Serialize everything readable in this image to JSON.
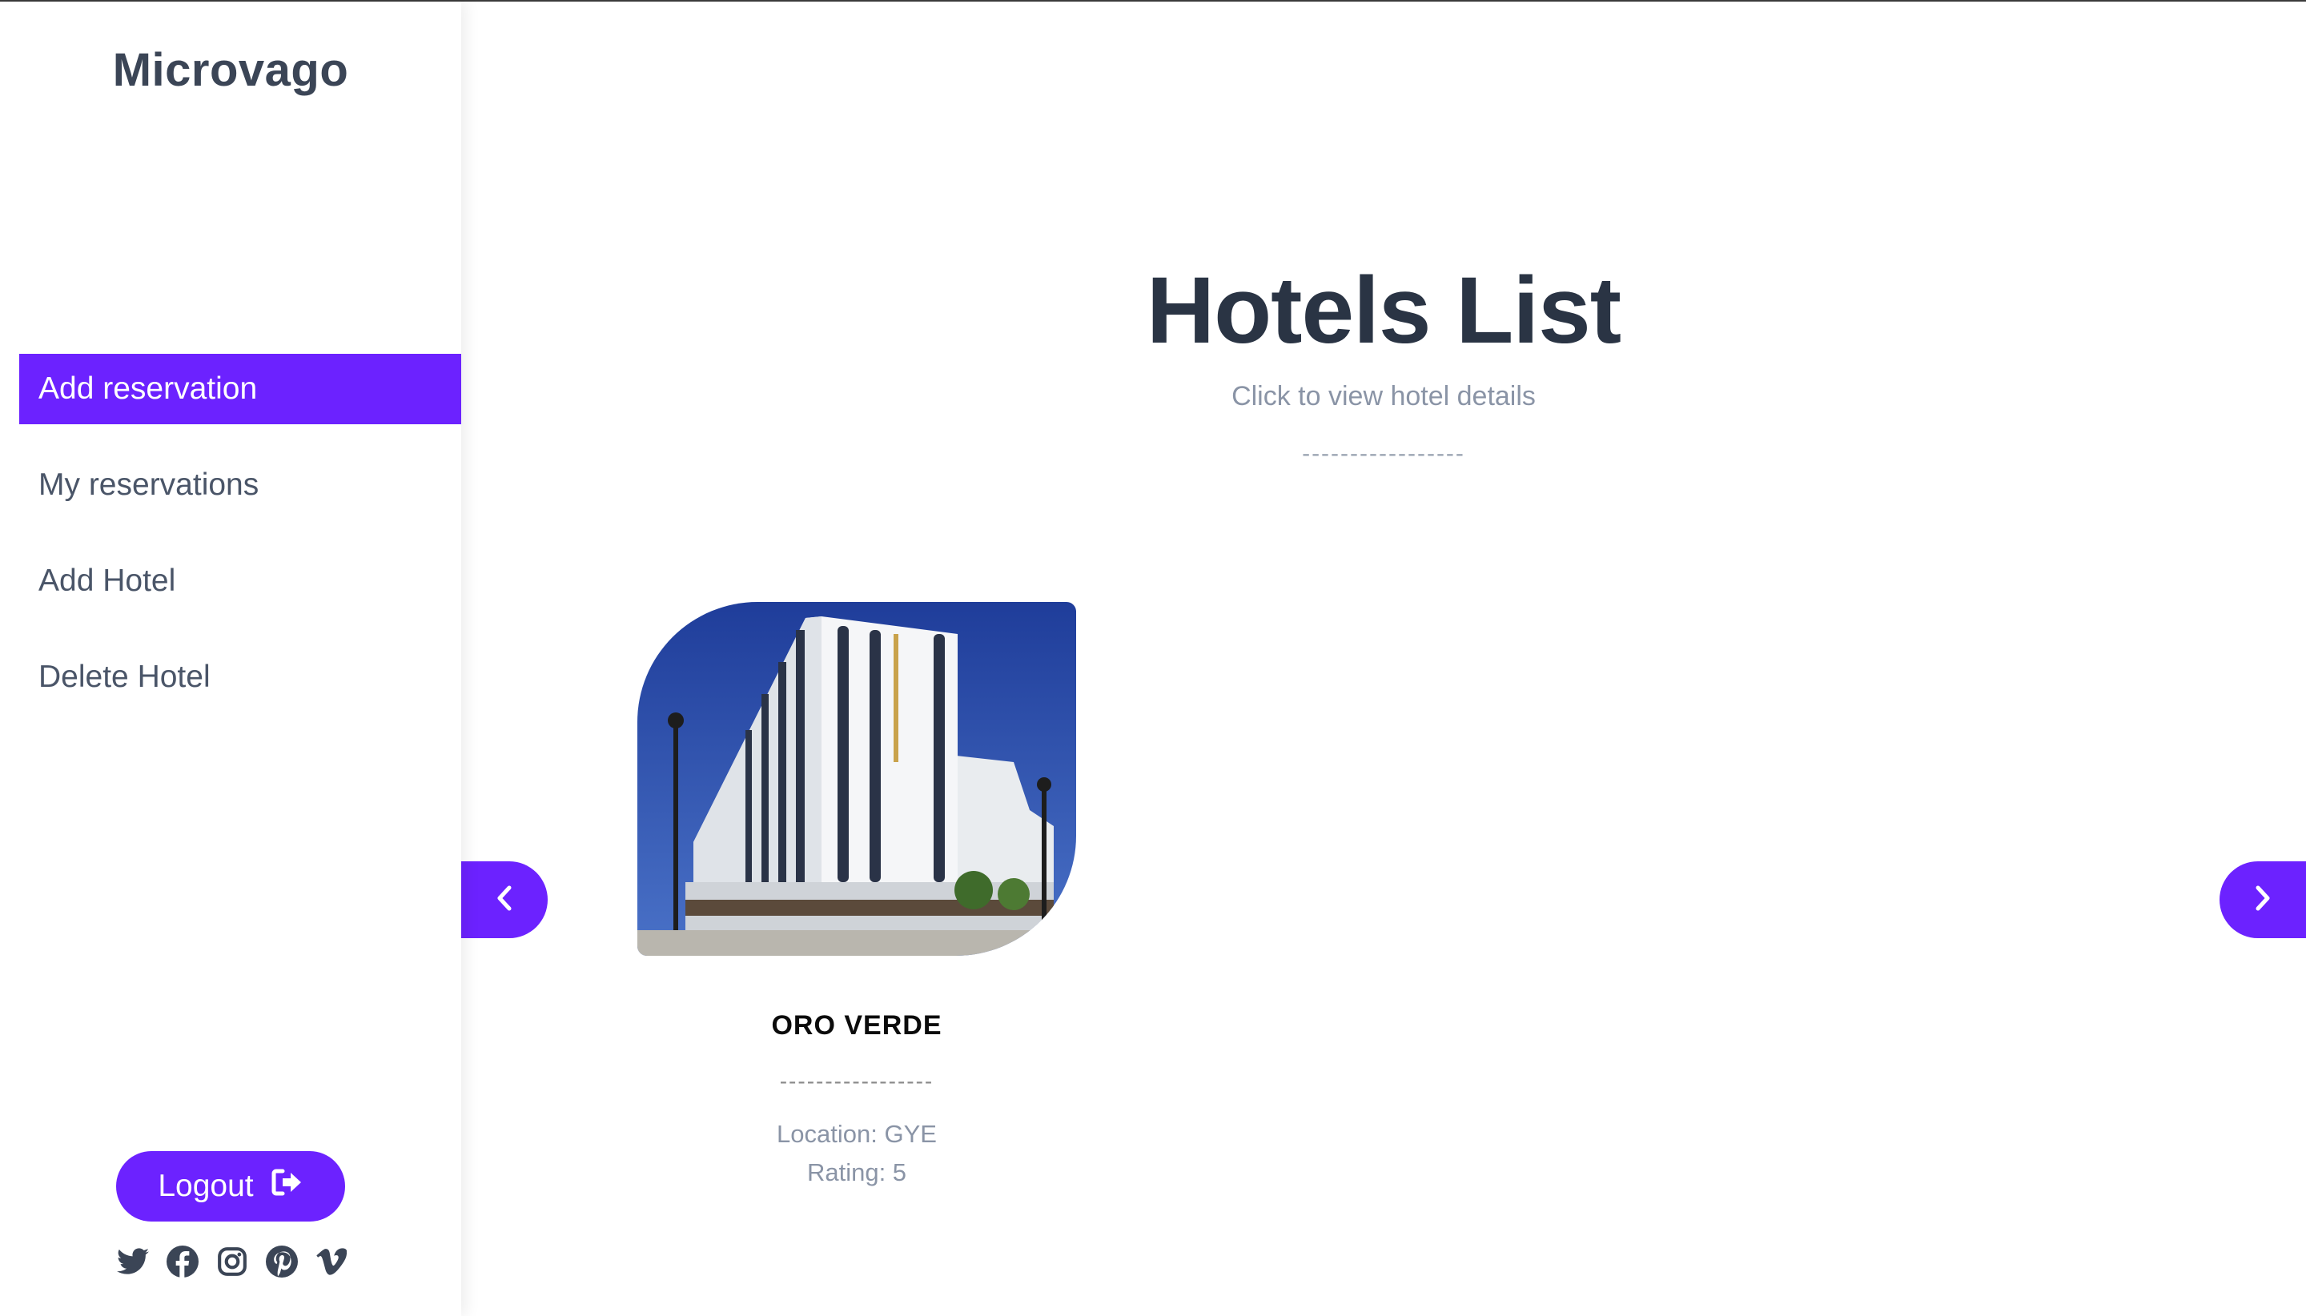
{
  "brand": "Microvago",
  "nav": [
    {
      "label": "Add reservation",
      "active": true
    },
    {
      "label": "My reservations",
      "active": false
    },
    {
      "label": "Add Hotel",
      "active": false
    },
    {
      "label": "Delete Hotel",
      "active": false
    }
  ],
  "logout_label": "Logout",
  "socials": [
    "twitter-icon",
    "facebook-icon",
    "instagram-icon",
    "pinterest-icon",
    "vimeo-icon"
  ],
  "page": {
    "title": "Hotels List",
    "subtitle": "Click to view hotel details",
    "divider": "-----------------"
  },
  "hotels": [
    {
      "name": "ORO VERDE",
      "divider": "-----------------",
      "location": "Location: GYE",
      "rating": "Rating: 5"
    }
  ],
  "colors": {
    "accent": "#6c22ff",
    "text_dark": "#2a3444",
    "text_muted": "#8a94a6"
  }
}
